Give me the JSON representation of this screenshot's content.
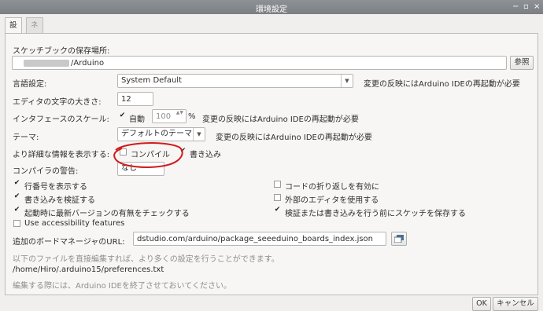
{
  "window": {
    "title": "環境設定",
    "controls": "- ▫ ×"
  },
  "tabs": [
    {
      "label": "設定",
      "active": true
    },
    {
      "label": "ネットワーク",
      "active": false
    }
  ],
  "sketchbook": {
    "label": "スケッチブックの保存場所:",
    "path_suffix": "/Arduino",
    "browse_label": "参照"
  },
  "language": {
    "label": "言語設定:",
    "value": "System Default",
    "note": "変更の反映にはArduino IDEの再起動が必要"
  },
  "font_size": {
    "label": "エディタの文字の大きさ:",
    "value": "12"
  },
  "scale": {
    "label": "インタフェースのスケール:",
    "auto_label": "自動",
    "value": "100",
    "unit": "%",
    "note": "変更の反映にはArduino IDEの再起動が必要"
  },
  "theme": {
    "label": "テーマ:",
    "value": "デフォルトのテーマ",
    "note": "変更の反映にはArduino IDEの再起動が必要"
  },
  "verbose": {
    "label": "より詳細な情報を表示する:",
    "compile_label": "コンパイル",
    "compile_checked": false,
    "upload_label": "書き込み",
    "upload_checked": true
  },
  "warnings": {
    "label": "コンパイラの警告:",
    "value": "なし"
  },
  "options_left": [
    {
      "label": "行番号を表示する",
      "checked": true
    },
    {
      "label": "書き込みを検証する",
      "checked": true
    },
    {
      "label": "起動時に最新バージョンの有無をチェックする",
      "checked": true
    },
    {
      "label": "Use accessibility features",
      "checked": false
    }
  ],
  "options_right": [
    {
      "label": "コードの折り返しを有効に",
      "checked": false
    },
    {
      "label": "外部のエディタを使用する",
      "checked": false
    },
    {
      "label": "検証または書き込みを行う前にスケッチを保存する",
      "checked": true
    }
  ],
  "boards_url": {
    "label": "追加のボードマネージャのURL:",
    "value": "dstudio.com/arduino/package_seeeduino_boards_index.json"
  },
  "footer": {
    "hint": "以下のファイルを直接編集すれば、より多くの設定を行うことができます。",
    "prefs_path": "/home/Hiro/.arduino15/preferences.txt",
    "close_hint": "編集する際には、Arduino IDEを終了させておいてください。"
  },
  "buttons": {
    "ok": "OK",
    "cancel": "キャンセル"
  },
  "colors": {
    "annotation": "#d11a1a",
    "titlebar": "#858a8e"
  },
  "icons": {
    "checked": "✔",
    "dropdown": "▼",
    "spin": "▲▼",
    "window_list": "window-list-icon"
  }
}
